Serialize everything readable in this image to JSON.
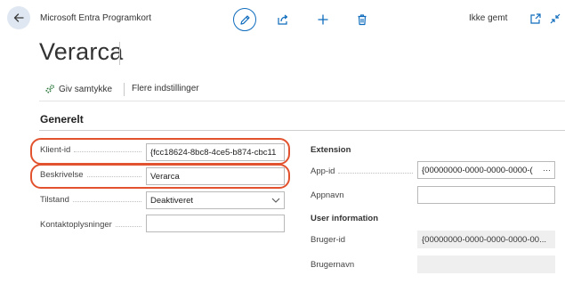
{
  "header": {
    "breadcrumb": "Microsoft Entra Programkort",
    "status": "Ikke gemt"
  },
  "page": {
    "title": "Verarca"
  },
  "actions": [
    {
      "label": "Giv samtykke"
    },
    {
      "label": "Flere indstillinger"
    }
  ],
  "section": {
    "title": "Generelt"
  },
  "fields_left": {
    "client_id": {
      "label": "Klient-id",
      "value": "{fcc18624-8bc8-4ce5-b874-cbc11"
    },
    "description": {
      "label": "Beskrivelse",
      "value": "Verarca"
    },
    "state": {
      "label": "Tilstand",
      "value": "Deaktiveret"
    },
    "contact": {
      "label": "Kontaktoplysninger",
      "value": ""
    }
  },
  "extension": {
    "heading": "Extension",
    "app_id": {
      "label": "App-id",
      "value": "{00000000-0000-0000-0000-(",
      "more": "···"
    },
    "app_name": {
      "label": "Appnavn",
      "value": ""
    }
  },
  "user_information": {
    "heading": "User information",
    "user_id": {
      "label": "Bruger-id",
      "value": "{00000000-0000-0000-0000-00..."
    },
    "user_name": {
      "label": "Brugernavn",
      "value": ""
    }
  },
  "colors": {
    "accent": "#0f6cbd",
    "highlight": "#e2522e",
    "consent_icon": "#2c7a3e"
  }
}
